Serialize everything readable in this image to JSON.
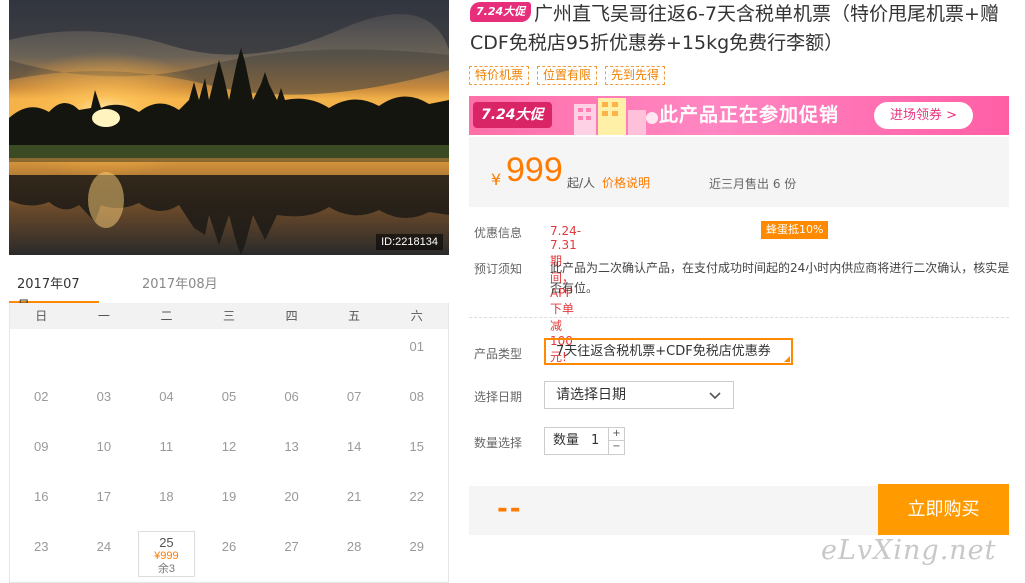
{
  "hero": {
    "image_id": "ID:2218134"
  },
  "calendar": {
    "months": [
      "2017年07月",
      "2017年08月"
    ],
    "weekdays": [
      "日",
      "一",
      "二",
      "三",
      "四",
      "五",
      "六"
    ],
    "days": [
      [
        "",
        "",
        "",
        "",
        "",
        "",
        "01"
      ],
      [
        "02",
        "03",
        "04",
        "05",
        "06",
        "07",
        "08"
      ],
      [
        "09",
        "10",
        "11",
        "12",
        "13",
        "14",
        "15"
      ],
      [
        "16",
        "17",
        "18",
        "19",
        "20",
        "21",
        "22"
      ],
      [
        "23",
        "24",
        "25",
        "26",
        "27",
        "28",
        "29"
      ]
    ],
    "available": {
      "day": "25",
      "price": "¥999",
      "remaining": "余3"
    }
  },
  "product": {
    "badge": "7.24大促",
    "title": "广州直飞吴哥往返6-7天含税单机票（特价甩尾机票+赠CDF免税店95折优惠券+15kg免费行李额）",
    "tags": [
      "特价机票",
      "位置有限",
      "先到先得"
    ]
  },
  "promo": {
    "badge": "7.24大促",
    "text": "此产品正在参加促销",
    "button": "进场领券 >"
  },
  "price": {
    "currency": "¥",
    "amount": "999",
    "unit": "起/人",
    "link": "价格说明",
    "sold": "近三月售出 6 份"
  },
  "info": {
    "discount_label": "优惠信息",
    "discount_text": "7.24-7.31期间，APP下单减100元!",
    "bee_badge": "蜂蛋抵10%",
    "notice_label": "预订须知",
    "notice_text": "此产品为二次确认产品，在支付成功时间起的24小时内供应商将进行二次确认，核实是否有位。"
  },
  "options": {
    "type_label": "产品类型",
    "type_value": "7天往返含税机票+CDF免税店优惠券",
    "date_label": "选择日期",
    "date_value": "请选择日期",
    "qty_label": "数量选择",
    "qty_prefix": "数量",
    "qty_value": "1",
    "plus": "+",
    "minus": "−"
  },
  "buy": {
    "total": "--",
    "button": "立即购买"
  },
  "watermark": "eLvXing.net",
  "colors": {
    "accent": "#ff8a00",
    "promo_pink": "#ff6fa8",
    "red": "#e4393c"
  }
}
